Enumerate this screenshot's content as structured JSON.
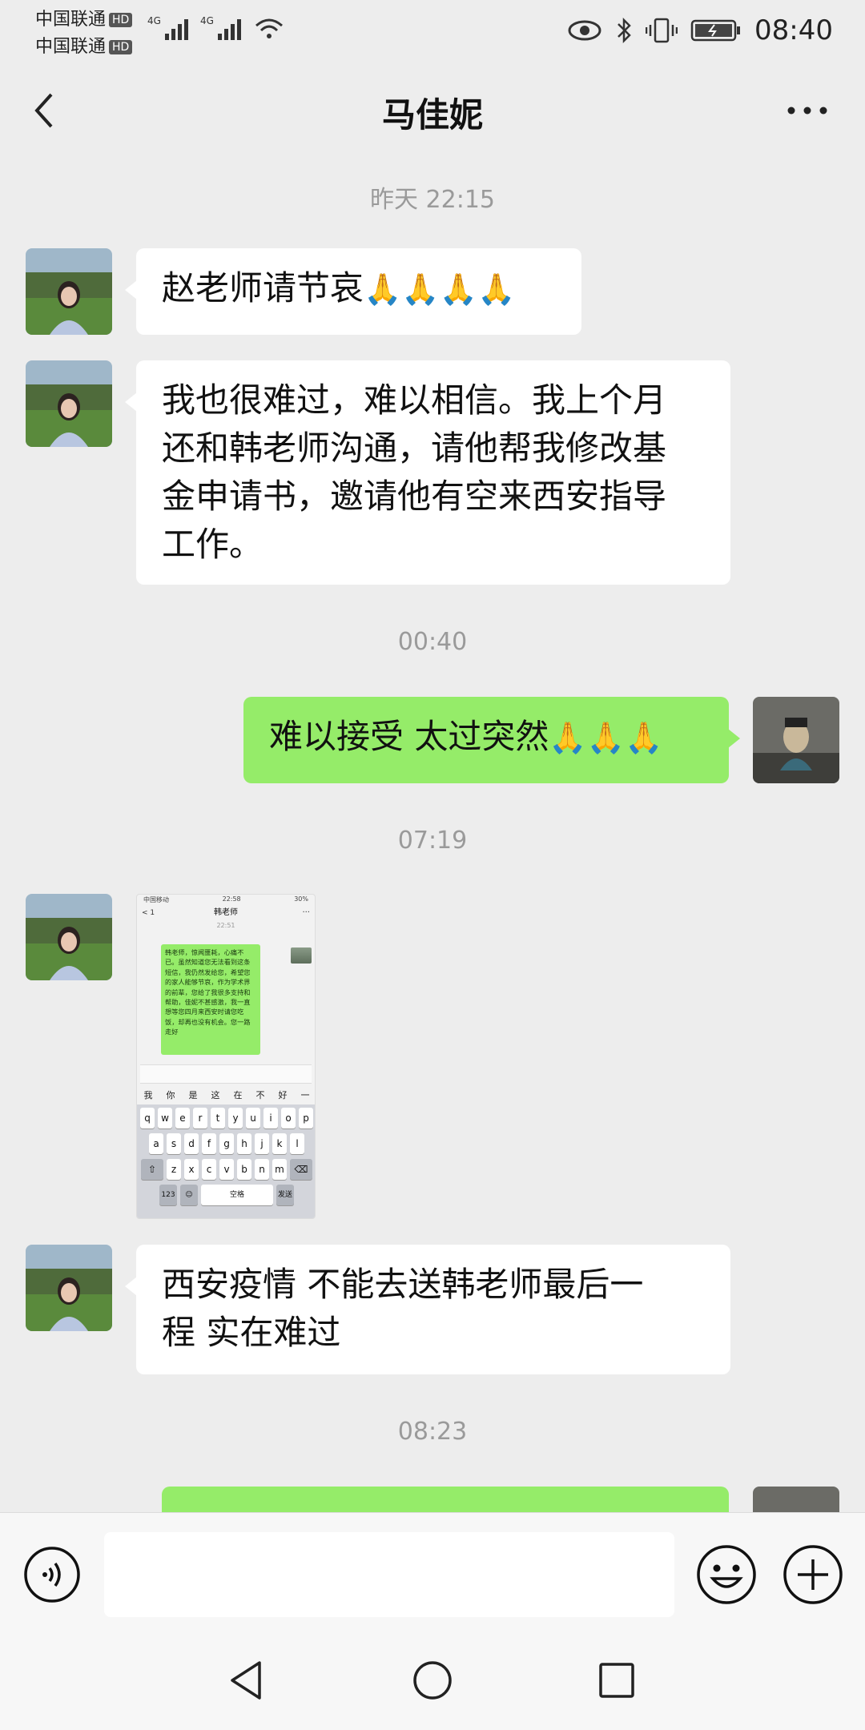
{
  "status_bar": {
    "carrier1": "中国联通",
    "carrier2": "中国联通",
    "hd": "HD",
    "net1": "4G",
    "net2": "4G",
    "time": "08:40"
  },
  "header": {
    "title": "马佳妮",
    "back_icon": "chevron-left-icon",
    "more_icon": "more-dots-icon"
  },
  "messages": [
    {
      "type": "time",
      "text": "昨天 22:15"
    },
    {
      "type": "text",
      "side": "left",
      "text": "赵老师请节哀",
      "emoji": "🙏🙏🙏🙏"
    },
    {
      "type": "text",
      "side": "left",
      "lines": [
        "我也很难过，难以相信。我上个月",
        "还和韩老师沟通，请他帮我修改基",
        "金申请书，邀请他有空来西安指导",
        "工作。"
      ]
    },
    {
      "type": "time",
      "text": "00:40"
    },
    {
      "type": "text",
      "side": "right",
      "text": "难以接受 太过突然",
      "emoji": "🙏🙏🙏"
    },
    {
      "type": "time",
      "text": "07:19"
    },
    {
      "type": "image",
      "side": "left",
      "screenshot": {
        "status_left": "中国移动",
        "status_time": "22:58",
        "status_right": "30%",
        "back_count": "1",
        "nav_title": "韩老师",
        "chat_time": "22:51",
        "bubble_text": "韩老师，惊闻噩耗，心痛不已。虽然知道您无法看到这条短信，我仍然发给您，希望您的家人能够节哀，作为学术界的前辈，您给了我很多支持和帮助，佳妮不甚感激，我一直想等您四月来西安时请您吃饭，却再也没有机会。您一路走好",
        "candidates": [
          "我",
          "你",
          "是",
          "这",
          "在",
          "不",
          "好",
          "一"
        ],
        "row1": [
          "q",
          "w",
          "e",
          "r",
          "t",
          "y",
          "u",
          "i",
          "o",
          "p"
        ],
        "row2": [
          "a",
          "s",
          "d",
          "f",
          "g",
          "h",
          "j",
          "k",
          "l"
        ],
        "row3": [
          "z",
          "x",
          "c",
          "v",
          "b",
          "n",
          "m"
        ],
        "key_123": "123",
        "key_space": "空格",
        "key_send": "发送"
      }
    },
    {
      "type": "text",
      "side": "left",
      "lines": [
        "西安疫情 不能去送韩老师最后一",
        "程 实在难过"
      ]
    },
    {
      "type": "time",
      "text": "08:23"
    }
  ],
  "input_bar": {
    "voice_icon": "voice-icon",
    "emoji_icon": "emoji-icon",
    "plus_icon": "plus-icon",
    "text_value": ""
  },
  "system_nav": {
    "back_icon": "triangle-back-icon",
    "home_icon": "circle-home-icon",
    "recent_icon": "square-recent-icon"
  },
  "colors": {
    "background": "#ededed",
    "right_bubble": "#95ec69",
    "left_bubble": "#ffffff",
    "time_label": "#9a9a9a"
  }
}
